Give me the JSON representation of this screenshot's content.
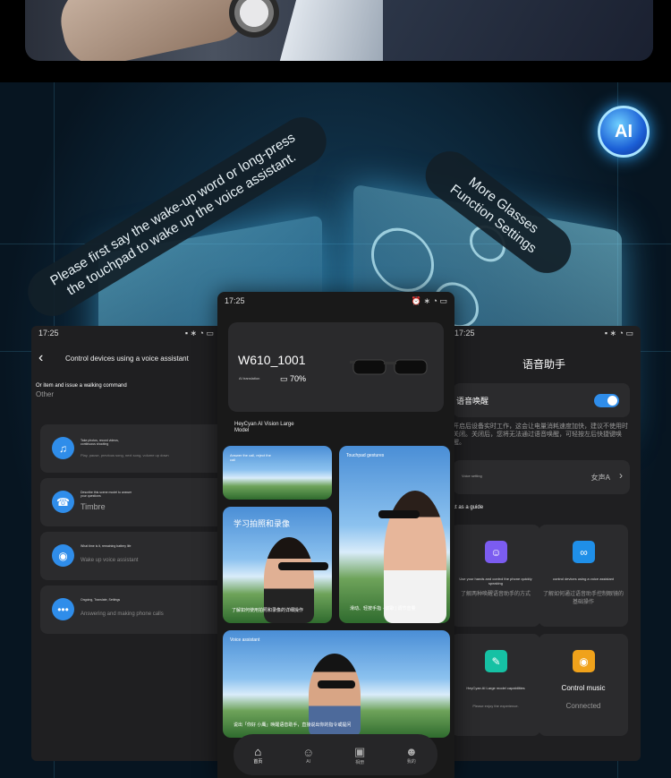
{
  "banners": {
    "left": "Please first say the wake-up word or long-press the touchpad to wake up the voice assistant.",
    "right": "More Glasses Function Settings",
    "ai_badge": "AI"
  },
  "left_phone": {
    "time": "17:25",
    "title": "Control devices using a voice assistant",
    "subtitle": "Or item and issue a walking command",
    "other": "Other",
    "items": [
      {
        "small": "Take photos, record videos, continuous shooting",
        "label": "Play, pause, previous song, next song, volume up down",
        "icon": "music-note-icon"
      },
      {
        "small": "Describe this scene model to answer your questions",
        "label": "Timbre",
        "icon": "phone-icon"
      },
      {
        "small": "What time is it, remaining battery life",
        "label": "Wake up voice assistant",
        "icon": "camera-icon"
      },
      {
        "small": "Ongoing, Translate, Settings",
        "label": "Answering and making phone calls",
        "icon": "more-icon"
      }
    ]
  },
  "mid_phone": {
    "time": "17:25",
    "device_name": "W610_1001",
    "ai_small": "AI translation",
    "battery": "70%",
    "section_label": "HeyCyan AI Vision Large Model",
    "tiles": {
      "call_label": "Answer the call, reject the call",
      "touchpad_label": "Touchpad gestures",
      "learn_cn": "学习拍照和录像",
      "learn_foot": "了解如何使用拍照和录像的详细操作",
      "touch_foot": "滑动、轻按手指 · 切歌 | 调节音量",
      "voice_label": "Voice assistant",
      "voice_foot": "说出「你好 小鹰」唤醒语音助手，直接说出你的指令或提问"
    },
    "tabs": [
      {
        "label": "首页",
        "icon": "home-icon"
      },
      {
        "label": "AI",
        "icon": "robot-icon"
      },
      {
        "label": "相册",
        "icon": "album-icon"
      },
      {
        "label": "我的",
        "icon": "profile-icon"
      }
    ]
  },
  "right_phone": {
    "time": "17:25",
    "title": "语音助手",
    "wake_label": "语音唤醒",
    "desc": "开启后设备实时工作，这会让电量消耗速度加快，建议不使用时关闭。关闭后，您将无法通过语音唤醒，可轻按左后快捷键唤醒。",
    "voice_small": "Voice setting",
    "voice_value": "女声A",
    "guide_label": "Act as a guide",
    "cards": [
      {
        "small": "Use your hands and control the phone quickly speaking",
        "desc": "了解两种唤醒语音助手的方式",
        "icon": "robot-face-icon",
        "color": "#7b5cf0"
      },
      {
        "small": "control devices using a voice assistant",
        "desc": "了解如何通过语音助手控制眼镜的基础操作",
        "icon": "glasses-icon",
        "color": "#1f8fe8"
      },
      {
        "small": "HeyCyan AI Large model capabilities",
        "desc": "Please enjoy the experience.",
        "icon": "note-icon",
        "color": "#16c1a4"
      },
      {
        "small": "Control music",
        "desc": "Connected",
        "icon": "eye-icon",
        "color": "#f0a21b"
      }
    ]
  }
}
